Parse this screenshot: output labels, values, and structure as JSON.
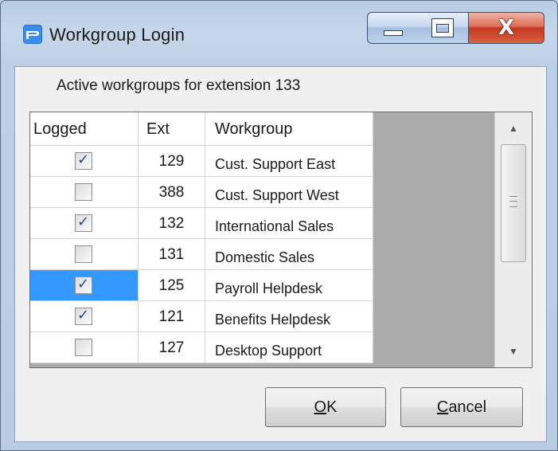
{
  "window": {
    "title": "Workgroup Login",
    "close_glyph": "X"
  },
  "subtitle": "Active workgroups for extension 133",
  "table": {
    "headers": {
      "logged": "Logged",
      "ext": "Ext",
      "workgroup": "Workgroup"
    },
    "rows": [
      {
        "logged": true,
        "ext": "129",
        "workgroup": "Cust. Support East"
      },
      {
        "logged": false,
        "ext": "388",
        "workgroup": "Cust. Support West"
      },
      {
        "logged": true,
        "ext": "132",
        "workgroup": "International Sales"
      },
      {
        "logged": false,
        "ext": "131",
        "workgroup": "Domestic Sales"
      },
      {
        "logged": true,
        "ext": "125",
        "workgroup": "Payroll Helpdesk",
        "selected": true
      },
      {
        "logged": true,
        "ext": "121",
        "workgroup": "Benefits Helpdesk"
      },
      {
        "logged": false,
        "ext": "127",
        "workgroup": "Desktop Support"
      }
    ]
  },
  "buttons": {
    "ok": {
      "mnemonic": "O",
      "rest": "K"
    },
    "cancel": {
      "mnemonic": "C",
      "rest": "ancel"
    }
  },
  "icons": {
    "app": "app-logo-icon",
    "minimize": "minimize-icon",
    "maximize": "maximize-icon",
    "close": "close-icon",
    "scroll_up": "scroll-up-arrow-icon",
    "scroll_down": "scroll-down-arrow-icon",
    "checkbox": "checkbox-icon"
  },
  "colors": {
    "selection": "#3399ff",
    "close_button": "#c4381f",
    "grid_empty_area": "#ababab"
  }
}
